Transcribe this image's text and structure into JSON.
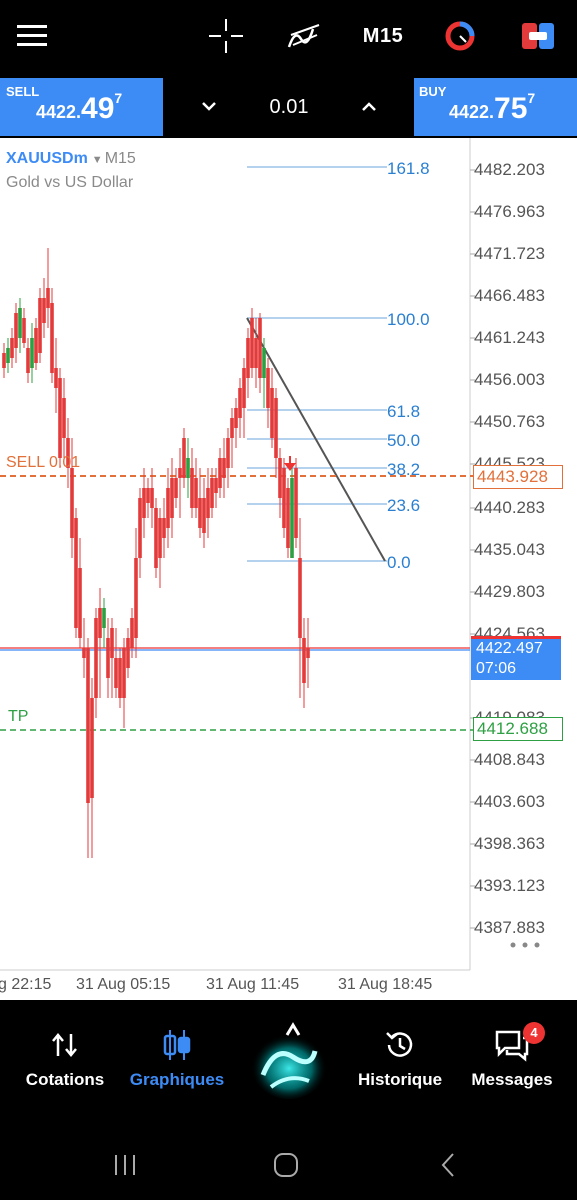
{
  "toolbar": {
    "menu_icon": "hamburger-menu-icon",
    "crosshair_icon": "crosshair-icon",
    "indicators_icon": "indicators-icon",
    "timeframe": "M15",
    "objects_icon": "chart-objects-icon",
    "trade_icon": "one-click-trade-icon"
  },
  "trade": {
    "sell_label": "SELL",
    "sell_price_small": "4422.",
    "sell_price_big": "49",
    "sell_price_sup": "7",
    "lot": "0.01",
    "buy_label": "BUY",
    "buy_price_small": "4422.",
    "buy_price_big": "75",
    "buy_price_sup": "7",
    "colors": {
      "box": "#3d8bf5"
    }
  },
  "chart": {
    "symbol": "XAUUSDm",
    "timeframe": "M15",
    "description": "Gold vs US Dollar",
    "price_levels": [
      "4482.203",
      "4476.963",
      "4471.723",
      "4466.483",
      "4461.243",
      "4456.003",
      "4450.763",
      "4445.523",
      "4440.283",
      "4435.043",
      "4429.803",
      "4424.563",
      "4419.083",
      "4408.843",
      "4403.603",
      "4398.363",
      "4393.123",
      "4387.883"
    ],
    "time_labels": [
      "g 22:15",
      "31 Aug 05:15",
      "31 Aug 11:45",
      "31 Aug 18:45"
    ],
    "fib_levels": [
      "161.8",
      "100.0",
      "61.8",
      "50.0",
      "38.2",
      "23.6",
      "0.0"
    ],
    "sell_order_label": "SELL 0.01",
    "sell_order_price": "4443.928",
    "tp_label": "TP",
    "tp_price": "4412.688",
    "bid_price": "4422.497",
    "bar_countdown": "07:06",
    "more_icon": "more-dots-icon",
    "colors": {
      "bull": "#2ea043",
      "bear": "#e33b3b",
      "sell_line": "#e2703a",
      "tp_line": "#2ea043",
      "fib": "#2a7fd0"
    }
  },
  "nav": {
    "items": [
      {
        "label": "Cotations",
        "icon": "quotes-arrows-icon"
      },
      {
        "label": "Graphiques",
        "icon": "candles-icon"
      },
      {
        "label": "",
        "icon": "app-logo-icon"
      },
      {
        "label": "Historique",
        "icon": "history-icon"
      },
      {
        "label": "Messages",
        "icon": "messages-icon",
        "badge": "4"
      }
    ]
  }
}
